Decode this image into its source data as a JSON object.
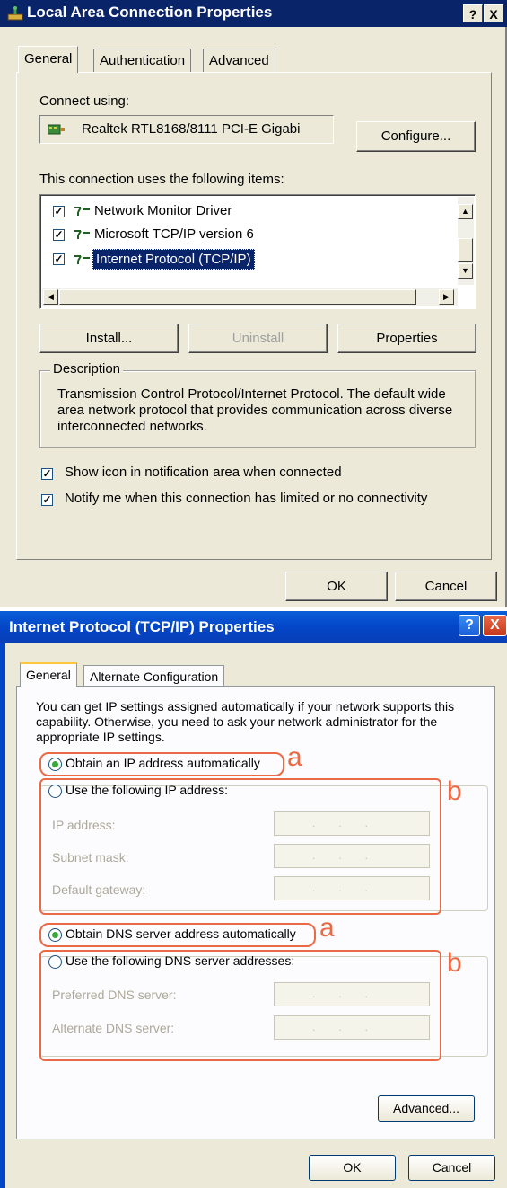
{
  "dialog1": {
    "title": "Local Area Connection Properties",
    "help_glyph": "?",
    "close_glyph": "X",
    "tabs": [
      "General",
      "Authentication",
      "Advanced"
    ],
    "connect_using_label": "Connect using:",
    "adapter_name": "Realtek RTL8168/8111 PCI-E Gigabi",
    "configure_button": "Configure...",
    "items_label": "This connection uses the following items:",
    "items": [
      {
        "label": "Network Monitor Driver",
        "checked": true
      },
      {
        "label": "Microsoft TCP/IP version 6",
        "checked": true
      },
      {
        "label": "Internet Protocol (TCP/IP)",
        "checked": true,
        "selected": true
      }
    ],
    "install_button": "Install...",
    "uninstall_button": "Uninstall",
    "properties_button": "Properties",
    "description_legend": "Description",
    "description_text": "Transmission Control Protocol/Internet Protocol. The default wide area network protocol that provides communication across diverse interconnected networks.",
    "show_icon_label": "Show icon in notification area when connected",
    "notify_label": "Notify me when this connection has limited or no connectivity",
    "ok_button": "OK",
    "cancel_button": "Cancel"
  },
  "dialog2": {
    "title": "Internet Protocol (TCP/IP) Properties",
    "help_glyph": "?",
    "close_glyph": "X",
    "tabs": [
      "General",
      "Alternate Configuration"
    ],
    "intro_text": "You can get IP settings assigned automatically if your network supports this capability. Otherwise, you need to ask your network administrator for the appropriate IP settings.",
    "obtain_ip_auto": "Obtain an IP address automatically",
    "use_following_ip": "Use the following IP address:",
    "ip_address_label": "IP address:",
    "subnet_mask_label": "Subnet mask:",
    "default_gateway_label": "Default gateway:",
    "obtain_dns_auto": "Obtain DNS server address automatically",
    "use_following_dns": "Use the following DNS server addresses:",
    "preferred_dns_label": "Preferred DNS server:",
    "alternate_dns_label": "Alternate DNS server:",
    "ip_placeholder": "...",
    "advanced_button": "Advanced...",
    "ok_button": "OK",
    "cancel_button": "Cancel",
    "annotation_a": "a",
    "annotation_b": "b"
  },
  "colors": {
    "annotation": "#ea6a45",
    "xp_title": "#0345c8",
    "classic_title": "#0a246a"
  }
}
